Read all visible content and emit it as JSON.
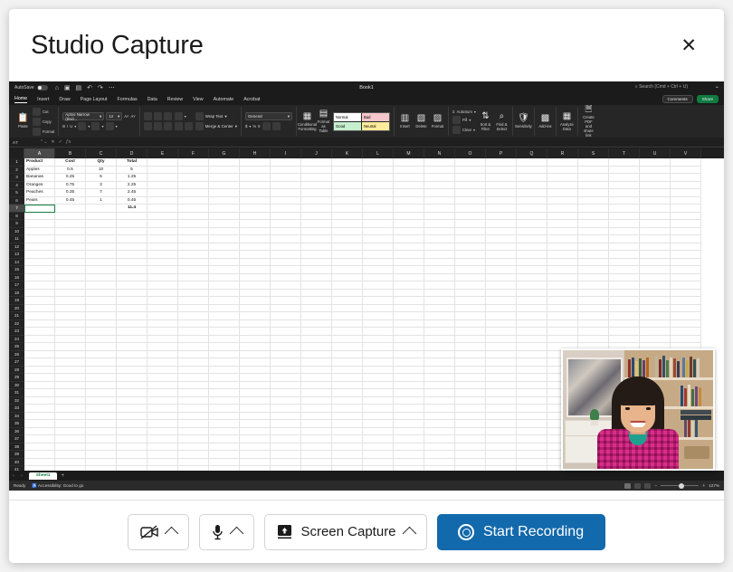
{
  "dialog": {
    "title": "Studio Capture",
    "close_label": "✕"
  },
  "controls": {
    "camera": {
      "name": "camera-off",
      "chevron": "chevron-up-icon"
    },
    "microphone": {
      "name": "microphone",
      "chevron": "chevron-up-icon"
    },
    "screen_capture": {
      "label": "Screen Capture",
      "icon": "screen-share-icon",
      "chevron": "chevron-up-icon"
    },
    "record": {
      "label": "Start Recording",
      "icon": "record-circle-icon",
      "color": "#1269ac"
    }
  },
  "excel": {
    "autosave_label": "AutoSave",
    "workbook_name": "Book1",
    "search_placeholder": "Search (Cmd + Ctrl + U)",
    "quick_access": [
      "home-icon",
      "save-icon",
      "print-icon",
      "undo-icon",
      "redo-icon",
      "more-icon"
    ],
    "tabs": [
      "Home",
      "Insert",
      "Draw",
      "Page Layout",
      "Formulas",
      "Data",
      "Review",
      "View",
      "Automate",
      "Acrobat"
    ],
    "active_tab": "Home",
    "comments_label": "Comments",
    "share_label": "Share",
    "clipboard": {
      "paste": "Paste",
      "cut": "Cut",
      "copy": "Copy",
      "format": "Format"
    },
    "font": {
      "family": "Aptos Narrow (Bod...",
      "size": "12",
      "grow": "A",
      "shrink": "A",
      "bold": "B",
      "italic": "I",
      "underline": "U"
    },
    "alignment": {
      "wrap_text": "Wrap Text",
      "merge_center": "Merge & Center"
    },
    "number": {
      "format": "General",
      "currency": "$",
      "percent": "%",
      "comma": "9"
    },
    "styles": {
      "conditional_formatting": "Conditional Formatting",
      "format_as_table": "Format as Table",
      "normal": "Normal",
      "bad": "Bad",
      "good": "Good",
      "neutral": "Neutral"
    },
    "cells": {
      "insert": "Insert",
      "delete": "Delete",
      "format": "Format"
    },
    "editing": {
      "autosum": "AutoSum",
      "fill": "Fill",
      "clear": "Clear",
      "sort_filter": "Sort & Filter",
      "find_select": "Find & Select"
    },
    "extras": {
      "sensitivity": "Sensitivity",
      "addins": "Add-ins",
      "analyze_data": "Analyze Data",
      "create_pdf": "Create PDF and share link"
    },
    "formula_bar": {
      "name_box": "A7",
      "formula": ""
    },
    "grid": {
      "columns": [
        "A",
        "B",
        "C",
        "D",
        "E",
        "F",
        "G",
        "H",
        "I",
        "J",
        "K",
        "L",
        "M",
        "N",
        "O",
        "P",
        "Q",
        "R",
        "S",
        "T",
        "U",
        "V"
      ],
      "selected_column": "A",
      "selected_row": 7,
      "rows": [
        {
          "n": 1,
          "cells": [
            "Product",
            "Cost",
            "Qty",
            "Total"
          ],
          "bold": true
        },
        {
          "n": 2,
          "cells": [
            "Apples",
            "0.5",
            "10",
            "5"
          ]
        },
        {
          "n": 3,
          "cells": [
            "Bananas",
            "0.25",
            "5",
            "1.25"
          ]
        },
        {
          "n": 4,
          "cells": [
            "Oranges",
            "0.75",
            "3",
            "2.25"
          ]
        },
        {
          "n": 5,
          "cells": [
            "Peaches",
            "0.35",
            "7",
            "2.45"
          ]
        },
        {
          "n": 6,
          "cells": [
            "Pears",
            "0.45",
            "1",
            "0.45"
          ]
        },
        {
          "n": 7,
          "cells": [
            "",
            "",
            "",
            "11.4"
          ],
          "bold_total": true
        }
      ],
      "empty_rows_to": 41
    },
    "sheet_tabs": {
      "active": "Sheet1",
      "add_label": "+"
    },
    "status_bar": {
      "ready": "Ready",
      "accessibility": "Accessibility: Good to go",
      "zoom": "127%"
    }
  }
}
